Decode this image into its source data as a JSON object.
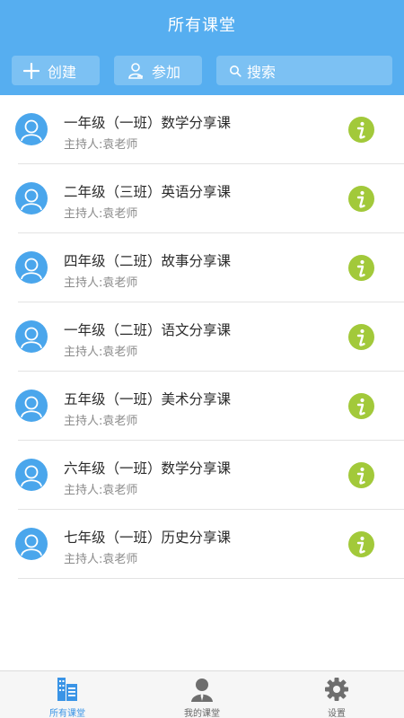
{
  "header": {
    "title": "所有课堂",
    "create_label": "创建",
    "join_label": "参加",
    "search_placeholder": "搜索"
  },
  "classes": [
    {
      "title": "一年级（一班）数学分享课",
      "host": "主持人:袁老师"
    },
    {
      "title": "二年级（三班）英语分享课",
      "host": "主持人:袁老师"
    },
    {
      "title": "四年级（二班）故事分享课",
      "host": "主持人:袁老师"
    },
    {
      "title": "一年级（二班）语文分享课",
      "host": "主持人:袁老师"
    },
    {
      "title": "五年级（一班）美术分享课",
      "host": "主持人:袁老师"
    },
    {
      "title": "六年级（一班）数学分享课",
      "host": "主持人:袁老师"
    },
    {
      "title": "七年级（一班）历史分享课",
      "host": "主持人:袁老师"
    }
  ],
  "tabbar": {
    "tabs": [
      {
        "label": "所有课堂",
        "icon": "building-icon",
        "active": true
      },
      {
        "label": "我的课堂",
        "icon": "person-icon",
        "active": false
      },
      {
        "label": "设置",
        "icon": "gear-icon",
        "active": false
      }
    ]
  },
  "colors": {
    "header_bg": "#56aef0",
    "button_bg": "#7cc1f3",
    "avatar_bg": "#4aa6ec",
    "info_icon": "#a2c93a",
    "active_tab": "#3a94e6"
  }
}
